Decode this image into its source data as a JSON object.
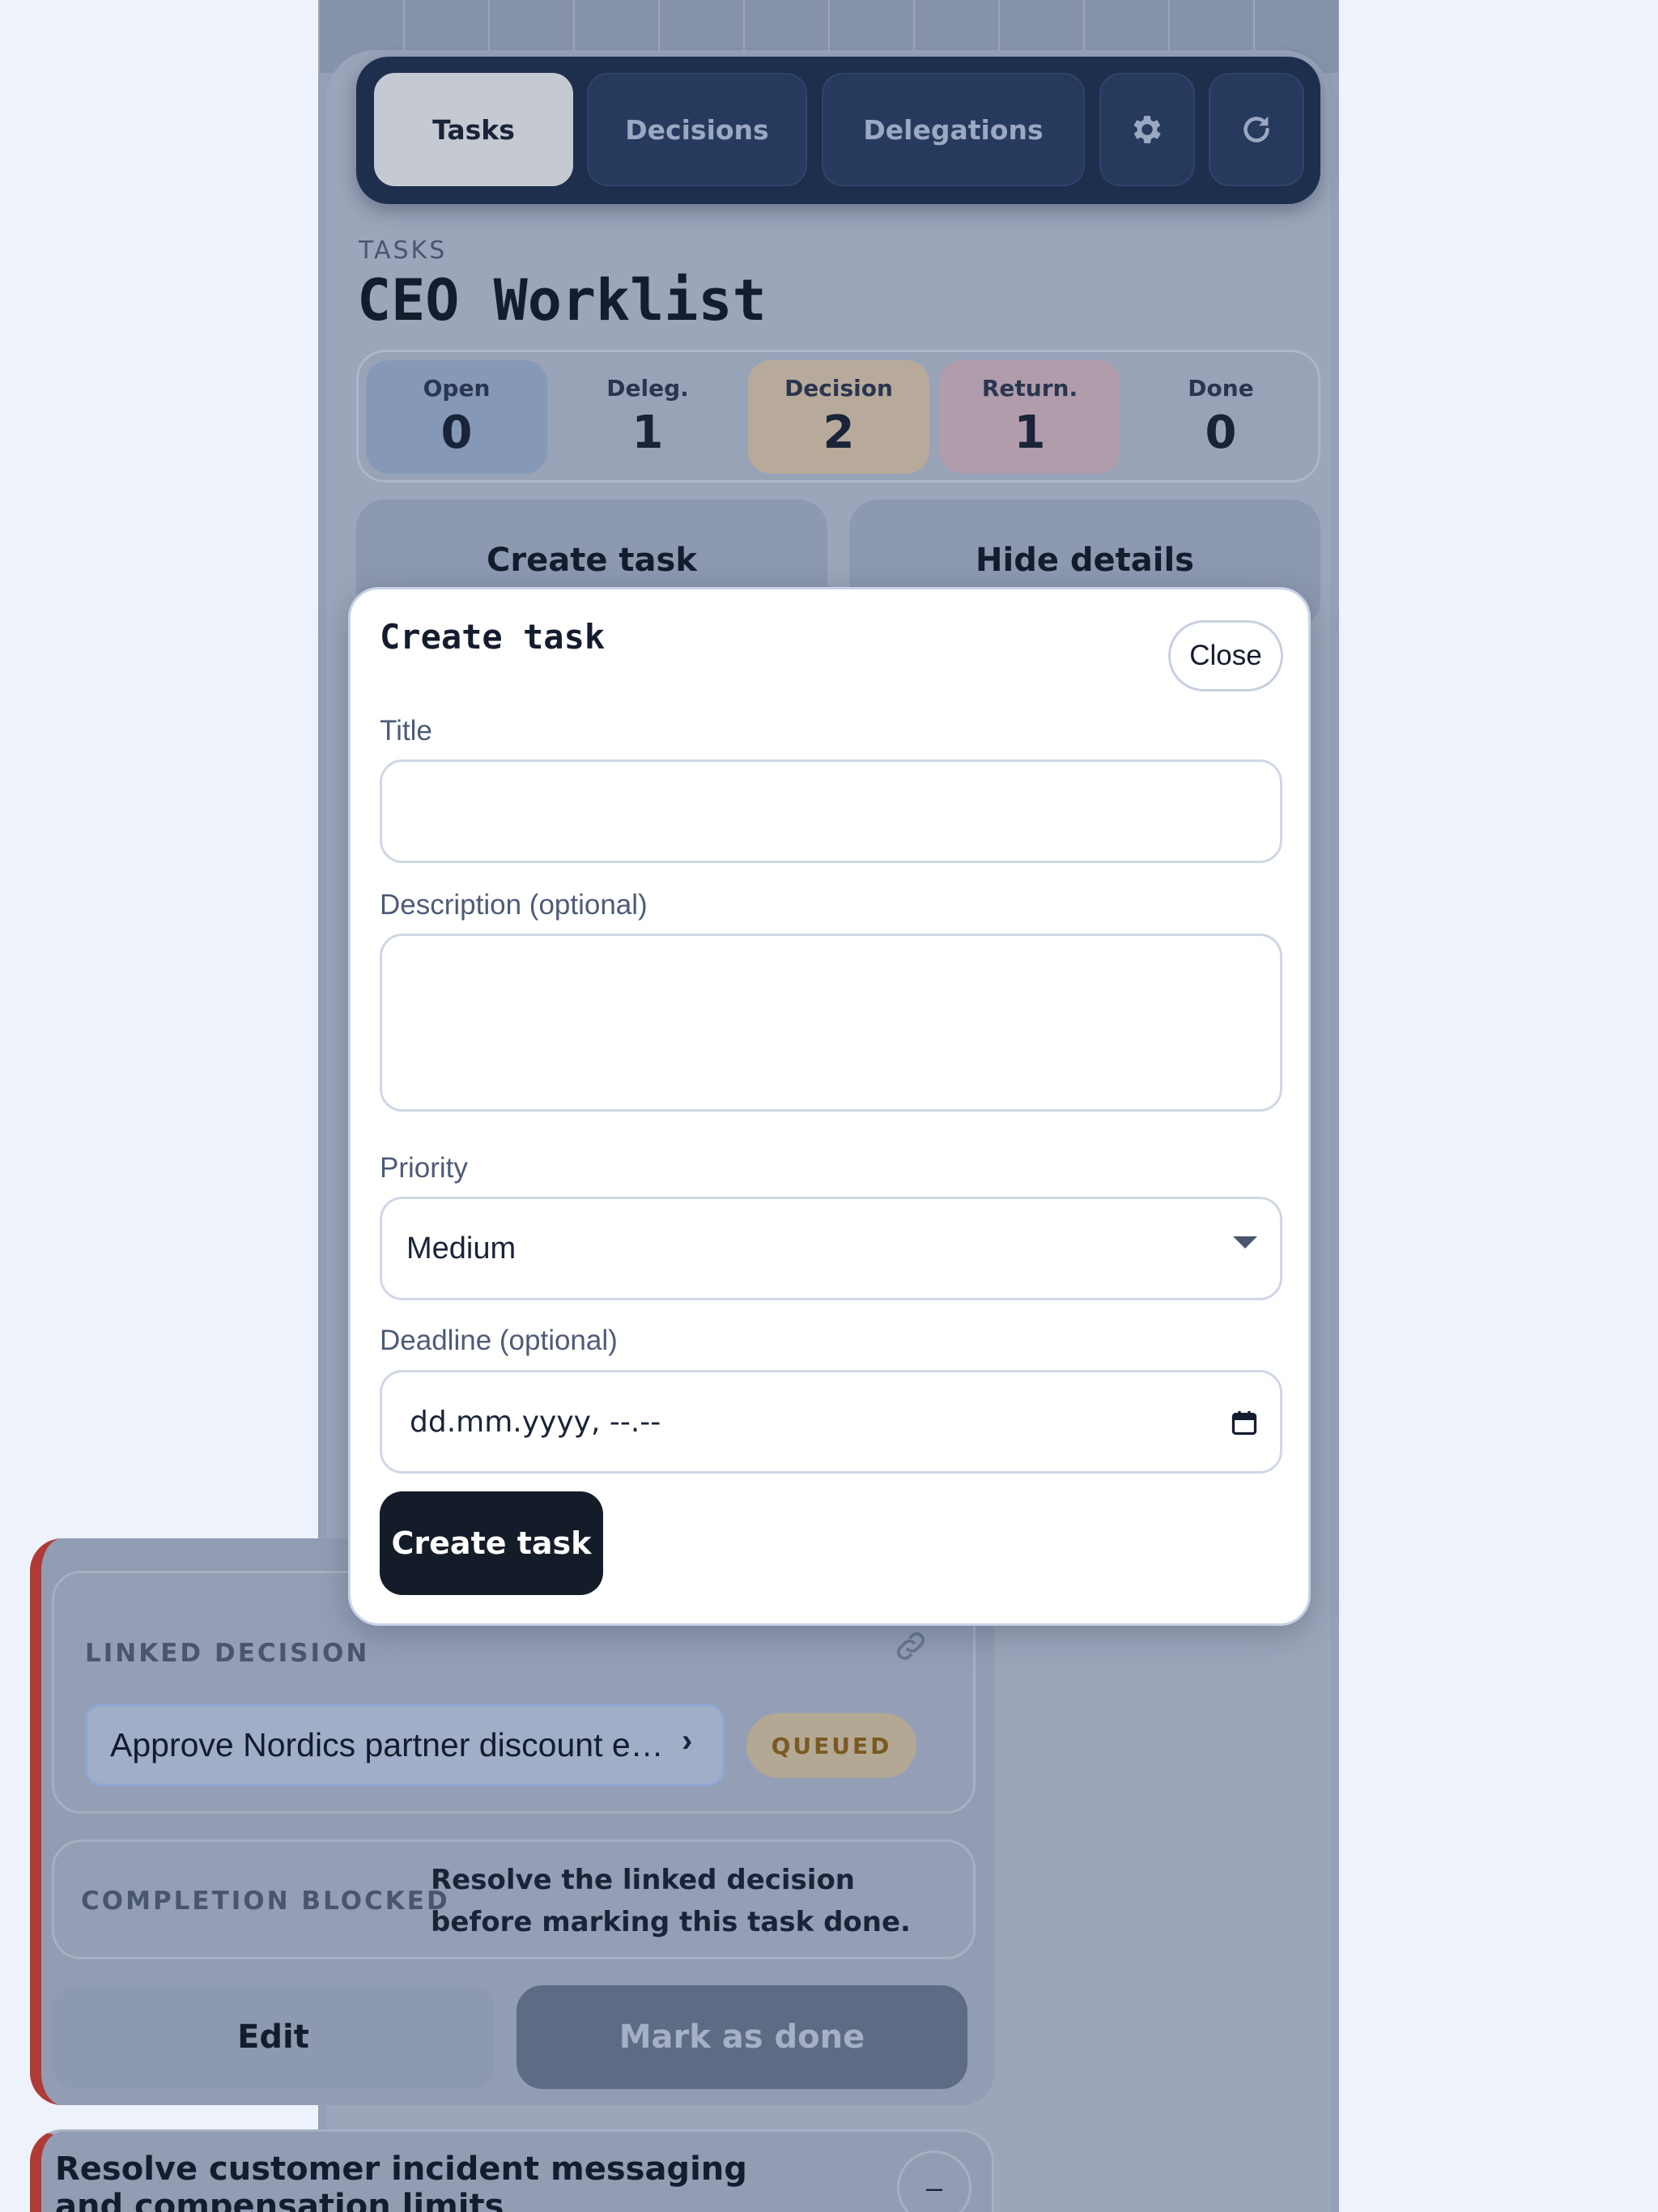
{
  "nav": {
    "tabs": [
      {
        "label": "Tasks",
        "active": true
      },
      {
        "label": "Decisions",
        "active": false
      },
      {
        "label": "Delegations",
        "active": false
      }
    ],
    "settings_icon": "gear-icon",
    "refresh_icon": "refresh-icon"
  },
  "header": {
    "eyebrow": "TASKS",
    "title": "CEO Worklist"
  },
  "counters": [
    {
      "label": "Open",
      "value": "0"
    },
    {
      "label": "Deleg.",
      "value": "1"
    },
    {
      "label": "Decision",
      "value": "2"
    },
    {
      "label": "Return.",
      "value": "1"
    },
    {
      "label": "Done",
      "value": "0"
    }
  ],
  "actions": {
    "create_task": "Create task",
    "hide_details": "Hide details"
  },
  "modal": {
    "title": "Create task",
    "close": "Close",
    "fields": {
      "title_label": "Title",
      "title_value": "",
      "description_label": "Description (optional)",
      "description_value": "",
      "priority_label": "Priority",
      "priority_value": "Medium",
      "deadline_label": "Deadline (optional)",
      "deadline_placeholder": "dd.mm.yyyy, --.--"
    },
    "submit": "Create task"
  },
  "task_card": {
    "linked_label": "LINKED DECISION",
    "linked_decision": "Approve Nordics partner discount e…",
    "linked_status": "QUEUED",
    "blocked_label": "COMPLETION BLOCKED",
    "blocked_text": "Resolve the linked decision before marking this task done.",
    "edit": "Edit",
    "mark_done": "Mark as done",
    "accent_color": "#b03a36"
  },
  "next_task": {
    "title": "Resolve customer incident messaging and compensation limits",
    "toggle": "–"
  }
}
